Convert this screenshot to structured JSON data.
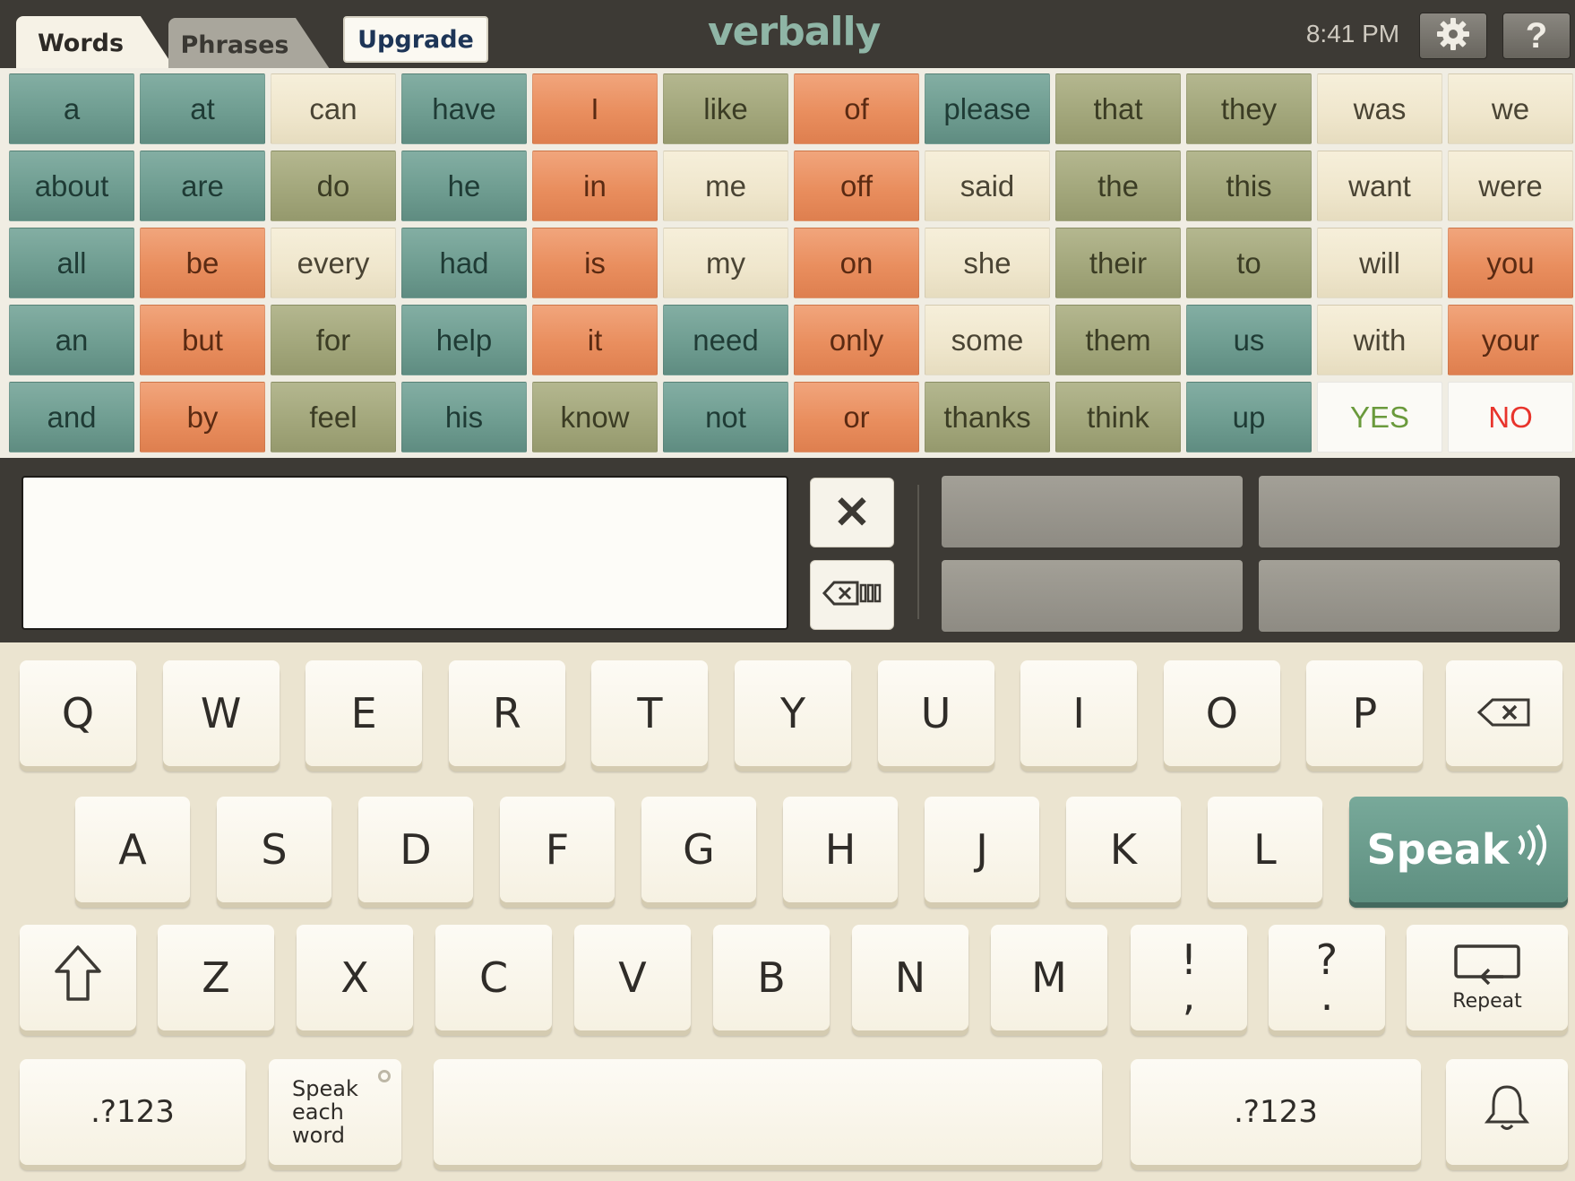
{
  "header": {
    "tabs": [
      {
        "label": "Words",
        "active": true
      },
      {
        "label": "Phrases",
        "active": false
      }
    ],
    "upgrade_label": "Upgrade",
    "logo_text": "verbally",
    "time": "8:41 PM",
    "settings_icon": "gear-icon",
    "help_label": "?"
  },
  "colors": {
    "teal": "#6f9d91",
    "orange": "#e98e5e",
    "olive": "#a3a77c",
    "cream": "#efe6cc",
    "yes": "#6a9a3c",
    "no": "#e8342c",
    "speak": "#5e8f80"
  },
  "word_grid": {
    "columns": [
      [
        {
          "w": "a",
          "c": "teal"
        },
        {
          "w": "about",
          "c": "teal"
        },
        {
          "w": "all",
          "c": "teal"
        },
        {
          "w": "an",
          "c": "teal"
        },
        {
          "w": "and",
          "c": "teal"
        }
      ],
      [
        {
          "w": "at",
          "c": "teal"
        },
        {
          "w": "are",
          "c": "teal"
        },
        {
          "w": "be",
          "c": "orange"
        },
        {
          "w": "but",
          "c": "orange"
        },
        {
          "w": "by",
          "c": "orange"
        }
      ],
      [
        {
          "w": "can",
          "c": "cream"
        },
        {
          "w": "do",
          "c": "olive"
        },
        {
          "w": "every",
          "c": "cream"
        },
        {
          "w": "for",
          "c": "olive"
        },
        {
          "w": "feel",
          "c": "olive"
        }
      ],
      [
        {
          "w": "have",
          "c": "teal"
        },
        {
          "w": "he",
          "c": "teal"
        },
        {
          "w": "had",
          "c": "teal"
        },
        {
          "w": "help",
          "c": "teal"
        },
        {
          "w": "his",
          "c": "teal"
        }
      ],
      [
        {
          "w": "I",
          "c": "orange"
        },
        {
          "w": "in",
          "c": "orange"
        },
        {
          "w": "is",
          "c": "orange"
        },
        {
          "w": "it",
          "c": "orange"
        },
        {
          "w": "know",
          "c": "olive"
        }
      ],
      [
        {
          "w": "like",
          "c": "olive"
        },
        {
          "w": "me",
          "c": "cream"
        },
        {
          "w": "my",
          "c": "cream"
        },
        {
          "w": "need",
          "c": "teal"
        },
        {
          "w": "not",
          "c": "teal"
        }
      ],
      [
        {
          "w": "of",
          "c": "orange"
        },
        {
          "w": "off",
          "c": "orange"
        },
        {
          "w": "on",
          "c": "orange"
        },
        {
          "w": "only",
          "c": "orange"
        },
        {
          "w": "or",
          "c": "orange"
        }
      ],
      [
        {
          "w": "please",
          "c": "teal"
        },
        {
          "w": "said",
          "c": "cream"
        },
        {
          "w": "she",
          "c": "cream"
        },
        {
          "w": "some",
          "c": "cream"
        },
        {
          "w": "thanks",
          "c": "olive"
        }
      ],
      [
        {
          "w": "that",
          "c": "olive"
        },
        {
          "w": "the",
          "c": "olive"
        },
        {
          "w": "their",
          "c": "olive"
        },
        {
          "w": "them",
          "c": "olive"
        },
        {
          "w": "think",
          "c": "olive"
        }
      ],
      [
        {
          "w": "they",
          "c": "olive"
        },
        {
          "w": "this",
          "c": "olive"
        },
        {
          "w": "to",
          "c": "olive"
        },
        {
          "w": "us",
          "c": "teal"
        },
        {
          "w": "up",
          "c": "teal"
        }
      ],
      [
        {
          "w": "was",
          "c": "cream"
        },
        {
          "w": "want",
          "c": "cream"
        },
        {
          "w": "will",
          "c": "cream"
        },
        {
          "w": "with",
          "c": "cream"
        },
        {
          "w": "YES",
          "c": "yes"
        }
      ],
      [
        {
          "w": "we",
          "c": "cream"
        },
        {
          "w": "were",
          "c": "cream"
        },
        {
          "w": "you",
          "c": "orange"
        },
        {
          "w": "your",
          "c": "orange"
        },
        {
          "w": "NO",
          "c": "no"
        }
      ]
    ]
  },
  "message": {
    "text": "",
    "clear_icon": "close-icon",
    "backspace_word_icon": "backspace-icon"
  },
  "keyboard": {
    "row1": [
      "Q",
      "W",
      "E",
      "R",
      "T",
      "Y",
      "U",
      "I",
      "O",
      "P"
    ],
    "row2": [
      "A",
      "S",
      "D",
      "F",
      "G",
      "H",
      "J",
      "K",
      "L"
    ],
    "row3": [
      "Z",
      "X",
      "C",
      "V",
      "B",
      "N",
      "M"
    ],
    "punct1_top": "!",
    "punct1_bottom": ",",
    "punct2_top": "?",
    "punct2_bottom": ".",
    "speak_label": "Speak",
    "repeat_label": "Repeat",
    "numbers_label_left": ".?123",
    "numbers_label_right": ".?123",
    "speak_each_word_line1": "Speak",
    "speak_each_word_line2": "each word"
  }
}
